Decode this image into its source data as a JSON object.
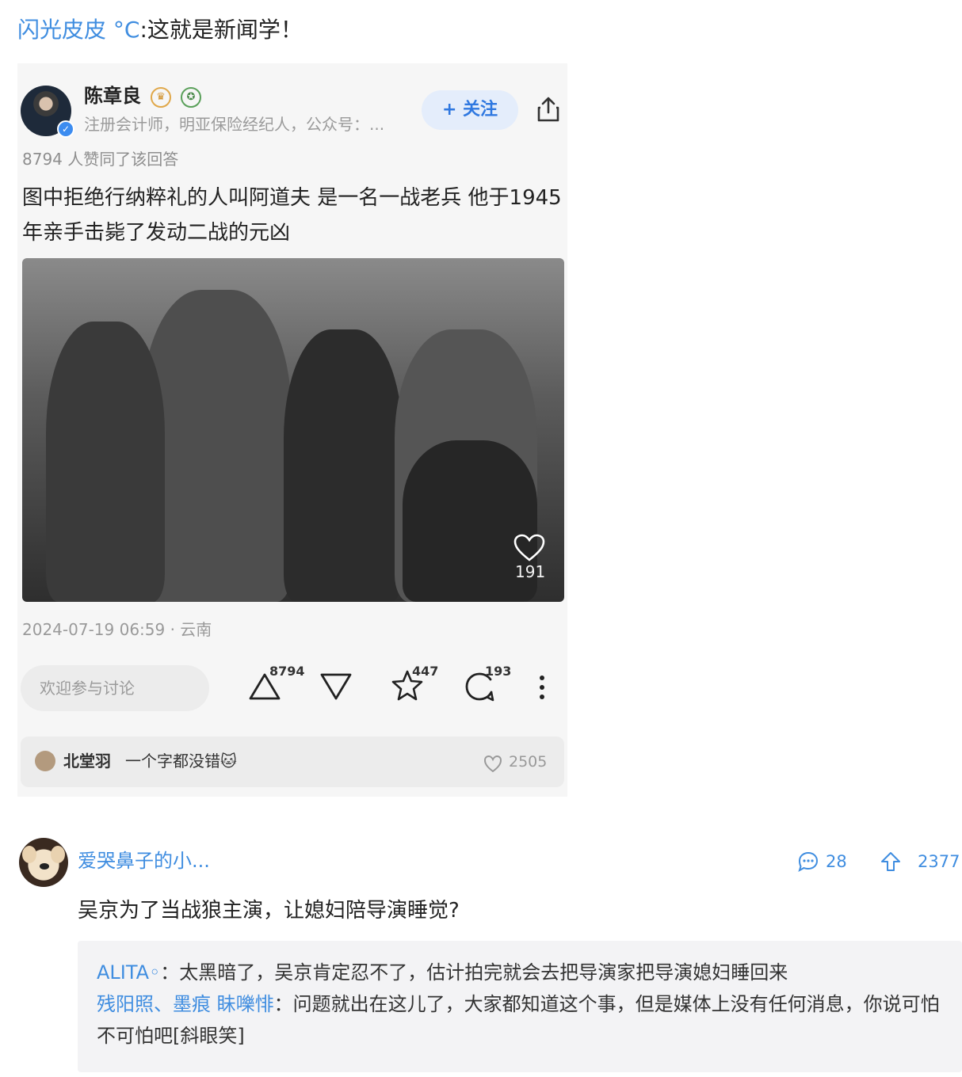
{
  "repost": {
    "username": "闪光皮皮 °C",
    "text": ":这就是新闻学！"
  },
  "card": {
    "author_name": "陈章良",
    "author_desc": "注册会计师，明亚保险经纪人，公众号：...",
    "follow_label": "+ 关注",
    "upvote_summary": "8794 人赞同了该回答",
    "answer_text": "图中拒绝行纳粹礼的人叫阿道夫 是一名一战老兵 他于1945年亲手击毙了发动二战的元凶",
    "photo_like_count": "191",
    "timestamp": "2024-07-19 06:59 · 云南",
    "comment_placeholder": "欢迎参与讨论",
    "upvotes": "8794",
    "favorites": "447",
    "comments": "193",
    "hot_comment": {
      "name": "北堂羽",
      "text": "一个字都没错🐱",
      "likes": "2505"
    }
  },
  "post": {
    "username": "爱哭鼻子的小...",
    "comment_count": "28",
    "upvote_count": "2377",
    "title": "吴京为了当战狼主演，让媳妇陪导演睡觉?",
    "replies": [
      {
        "name": "ALITA◦",
        "sep": "：",
        "text": "太黑暗了，吴京肯定忍不了，估计拍完就会去把导演家把导演媳妇睡回来"
      },
      {
        "name": "残阳照、墨痕 眛嚛悱",
        "sep": "：",
        "text": "问题就出在这儿了，大家都知道这个事，但是媒体上没有任何消息，你说可怕不可怕吧[斜眼笑]"
      }
    ]
  },
  "colors": {
    "link_blue": "#3f8de0",
    "follow_bg": "#e4edfb",
    "card_bg": "#f6f6f6"
  },
  "icons": [
    "verified-icon",
    "crown-badge-icon",
    "medal-badge-icon",
    "share-icon",
    "heart-icon",
    "upvote-icon",
    "downvote-icon",
    "star-icon",
    "comment-icon",
    "more-icon",
    "up-arrow-icon"
  ]
}
